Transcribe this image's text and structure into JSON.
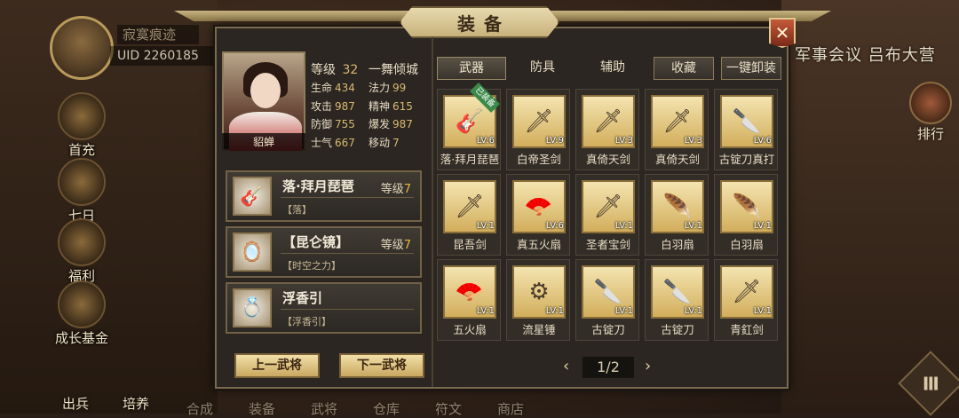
{
  "hud": {
    "player_name": "寂寞痕迹",
    "uid": "UID  2260185",
    "side_buttons": [
      "首充",
      "七日",
      "福利",
      "成长基金"
    ],
    "bottom_buttons": [
      "出兵",
      "培养",
      "合成",
      "装备",
      "武将",
      "仓库",
      "符文",
      "商店"
    ],
    "right_title": "军事会议 吕布大营",
    "rank_label": "排行",
    "menu_icon": "Ⅲ"
  },
  "panel": {
    "title": "装备",
    "close_label": "✕"
  },
  "hero": {
    "portrait_name": "貂蝉",
    "level_label": "等级",
    "level": "32",
    "class_name": "一舞倾城",
    "stats": [
      {
        "label": "生命",
        "value": "434"
      },
      {
        "label": "法力",
        "value": "99"
      },
      {
        "label": "攻击",
        "value": "987"
      },
      {
        "label": "精神",
        "value": "615"
      },
      {
        "label": "防御",
        "value": "755"
      },
      {
        "label": "爆发",
        "value": "987"
      },
      {
        "label": "士气",
        "value": "667"
      },
      {
        "label": "移动",
        "value": "7"
      }
    ]
  },
  "equipped": [
    {
      "name": "落·拜月琵琶",
      "level_label": "等级",
      "level": "7",
      "desc": "【落】",
      "icon": "lute-icon",
      "glyph": "🎸"
    },
    {
      "name": "【昆仑镜】",
      "level_label": "等级",
      "level": "7",
      "desc": "【时空之力】",
      "icon": "mirror-icon",
      "glyph": "🪞"
    },
    {
      "name": "浮香引",
      "level_label": "",
      "level": "",
      "desc": "【浮香引】",
      "icon": "bracelet-icon",
      "glyph": "💍"
    }
  ],
  "nav": {
    "prev": "上一武将",
    "next": "下一武将"
  },
  "tabs": [
    {
      "label": "武器",
      "active": true
    },
    {
      "label": "防具",
      "active": false
    },
    {
      "label": "辅助",
      "active": false
    },
    {
      "label": "收藏",
      "active": false
    },
    {
      "label": "一键卸装",
      "active": false
    }
  ],
  "equipped_tag": "已装备",
  "items": [
    {
      "name": "落·拜月琵琶",
      "lv": "LV:6",
      "icon": "lute-icon",
      "glyph": "🎸"
    },
    {
      "name": "白帝圣剑",
      "lv": "LV:9",
      "icon": "sword-icon",
      "glyph": "🗡"
    },
    {
      "name": "真倚天剑",
      "lv": "LV:3",
      "icon": "sword-icon",
      "glyph": "🗡"
    },
    {
      "name": "真倚天剑",
      "lv": "LV:3",
      "icon": "sword-icon",
      "glyph": "🗡"
    },
    {
      "name": "古锭刀真打",
      "lv": "LV:6",
      "icon": "blade-icon",
      "glyph": "🔪"
    },
    {
      "name": "昆吾剑",
      "lv": "LV:1",
      "icon": "sword-icon",
      "glyph": "🗡"
    },
    {
      "name": "真五火扇",
      "lv": "LV:6",
      "icon": "fire-fan-icon",
      "glyph": "🪭"
    },
    {
      "name": "圣者宝剑",
      "lv": "LV:1",
      "icon": "sword-icon",
      "glyph": "🗡"
    },
    {
      "name": "白羽扇",
      "lv": "LV:1",
      "icon": "feather-fan-icon",
      "glyph": "🪶"
    },
    {
      "name": "白羽扇",
      "lv": "LV:1",
      "icon": "feather-fan-icon",
      "glyph": "🪶"
    },
    {
      "name": "五火扇",
      "lv": "LV:1",
      "icon": "fire-fan-icon",
      "glyph": "🪭"
    },
    {
      "name": "流星锤",
      "lv": "LV:1",
      "icon": "meteor-hammer-icon",
      "glyph": "⚙"
    },
    {
      "name": "古锭刀",
      "lv": "LV:1",
      "icon": "blade-icon",
      "glyph": "🔪"
    },
    {
      "name": "古锭刀",
      "lv": "LV:1",
      "icon": "blade-icon",
      "glyph": "🔪"
    },
    {
      "name": "青釭剑",
      "lv": "LV:1",
      "icon": "sword-icon",
      "glyph": "🗡"
    }
  ],
  "pager": {
    "prev": "‹",
    "page": "1/2",
    "next": "›"
  }
}
